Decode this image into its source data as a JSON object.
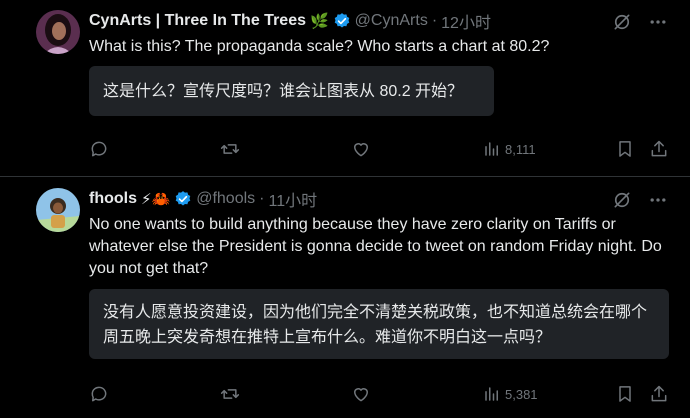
{
  "tweets": [
    {
      "name": "CynArts | Three In The Trees",
      "name_emoji": "🌿",
      "handle": "@CynArts",
      "dot": "·",
      "time": "12小时",
      "text": "What is this? The propaganda scale? Who starts a chart at 80.2?",
      "translation": "这是什么？宣传尺度吗？谁会让图表从 80.2 开始？",
      "views": "8,111"
    },
    {
      "name": "fhools",
      "name_emoji": "⚡🦀",
      "handle": "@fhools",
      "dot": "·",
      "time": "11小时",
      "text": "No one wants to build anything because they have zero clarity on Tariffs or whatever else the President is gonna decide to tweet on random Friday night. Do you not get that?",
      "translation": "没有人愿意投资建设，因为他们完全不清楚关税政策，也不知道总统会在哪个周五晚上突发奇想在推特上宣布什么。难道你不明白这一点吗？",
      "views": "5,381"
    }
  ],
  "colors": {
    "background": "#000000",
    "text": "#e7e9ea",
    "muted": "#71767b",
    "verified": "#1d9bf0",
    "translate_box": "#202327",
    "divider": "#2f3336"
  },
  "icons": [
    "verified-badge-icon",
    "grok-icon",
    "more-icon",
    "reply-icon",
    "retweet-icon",
    "like-icon",
    "views-icon",
    "bookmark-icon",
    "share-icon"
  ]
}
